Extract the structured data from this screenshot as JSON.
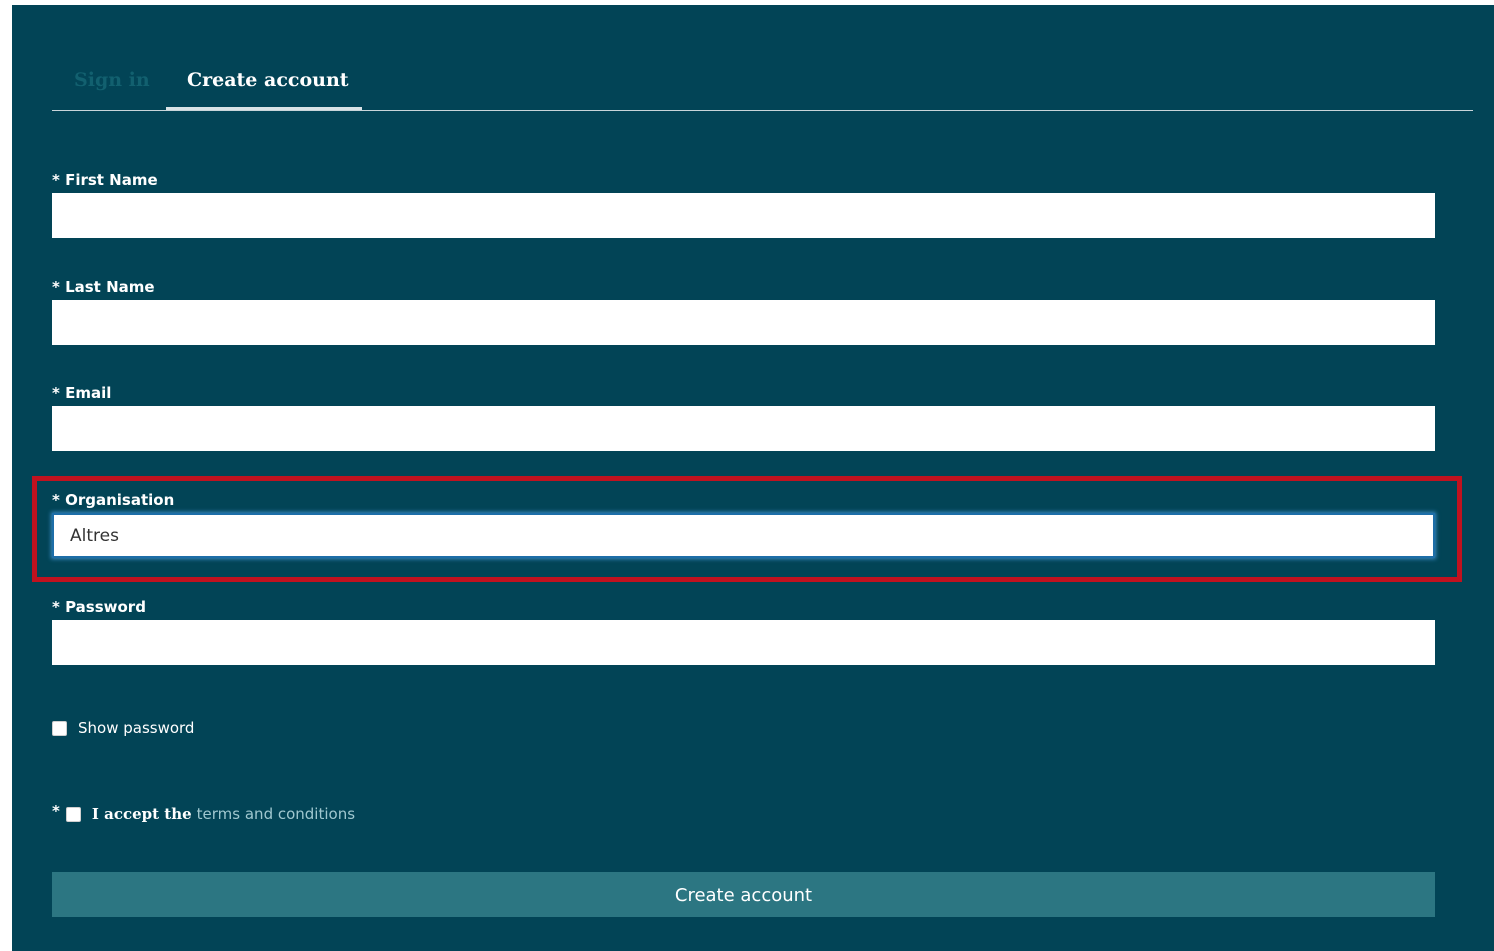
{
  "tabs": {
    "signin": "Sign in",
    "create": "Create account"
  },
  "form": {
    "first_name_label": "* First Name",
    "first_name_value": "",
    "last_name_label": "* Last Name",
    "last_name_value": "",
    "email_label": "* Email",
    "email_value": "",
    "organisation_label": "* Organisation",
    "organisation_value": "Altres",
    "password_label": "* Password",
    "password_value": "",
    "show_password_label": "Show password",
    "terms_required_marker": "*",
    "terms_prefix": "I accept the",
    "terms_link": "terms and conditions",
    "submit_label": "Create account"
  },
  "colors": {
    "panel_bg": "#024456",
    "button_bg": "#2c7682",
    "highlight": "#c1121f",
    "link": "#9fc7cf"
  }
}
